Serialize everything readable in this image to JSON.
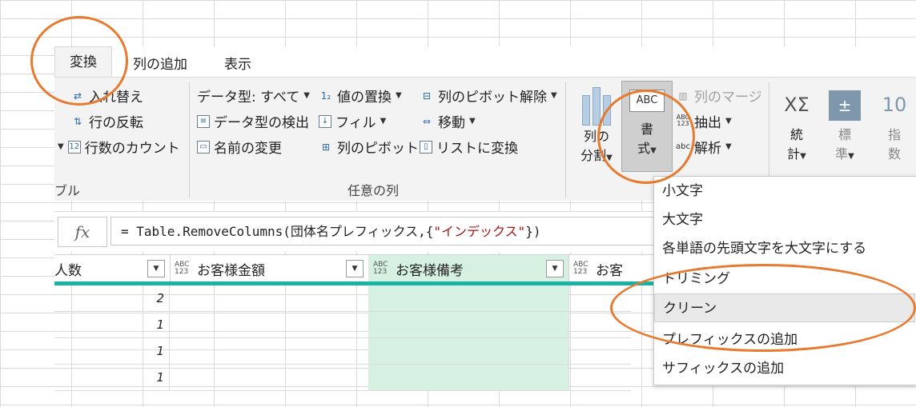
{
  "tabs": [
    "変換",
    "列の追加",
    "表示"
  ],
  "ribbon": {
    "table_group": {
      "items": [
        "入れ替え",
        "行の反転",
        "行数のカウント"
      ],
      "label_fragment": "ブル"
    },
    "any_column_group": {
      "label": "任意の列",
      "col1": [
        "データ型: すべて",
        "データ型の検出",
        "名前の変更"
      ],
      "col2": [
        "値の置換",
        "フィル",
        "列のピボット"
      ],
      "col3": [
        "列のピボット解除",
        "移動",
        "リストに変換"
      ],
      "value_replace_icon": "1₂"
    },
    "text_group": {
      "split_column": [
        "列の",
        "分割"
      ],
      "format": [
        "書",
        "式"
      ],
      "format_icon_text": "ABC",
      "merge_columns": "列のマージ",
      "extract": "抽出",
      "parse": "解析",
      "type_icon_abc": "ABC",
      "type_icon_123": "123",
      "parse_icon_text": "abc"
    },
    "number_group": {
      "statistics": [
        "統",
        "計"
      ],
      "standard": [
        "標",
        "準"
      ],
      "scientific": [
        "指",
        "数"
      ],
      "stat_icon": "XΣ",
      "standard_icon": "±",
      "scientific_icon": "10"
    }
  },
  "formula": {
    "fx_label": "fx",
    "prefix": "= Table.RemoveColumns(団体名プレフィックス,{",
    "string": "\"インデックス\"",
    "suffix": "})"
  },
  "columns": [
    {
      "name": "人数",
      "type": ""
    },
    {
      "name": "お客様金額",
      "type": "ABC 123"
    },
    {
      "name": "お客様備考",
      "type": "ABC 123"
    },
    {
      "name": "お客",
      "type": "ABC 123"
    }
  ],
  "rows": [
    {
      "count": "2"
    },
    {
      "count": "1"
    },
    {
      "count": "1"
    },
    {
      "count": "1"
    }
  ],
  "format_menu": {
    "items": [
      "小文字",
      "大文字",
      "各単語の先頭文字を大文字にする",
      "トリミング",
      "クリーン",
      "プレフィックスの追加",
      "サフィックスの追加"
    ],
    "hovered": "クリーン"
  },
  "colors": {
    "accent_annotation": "#e87a30",
    "selected_column": "#d6f0e2",
    "header_bar": "#19b3a4"
  }
}
